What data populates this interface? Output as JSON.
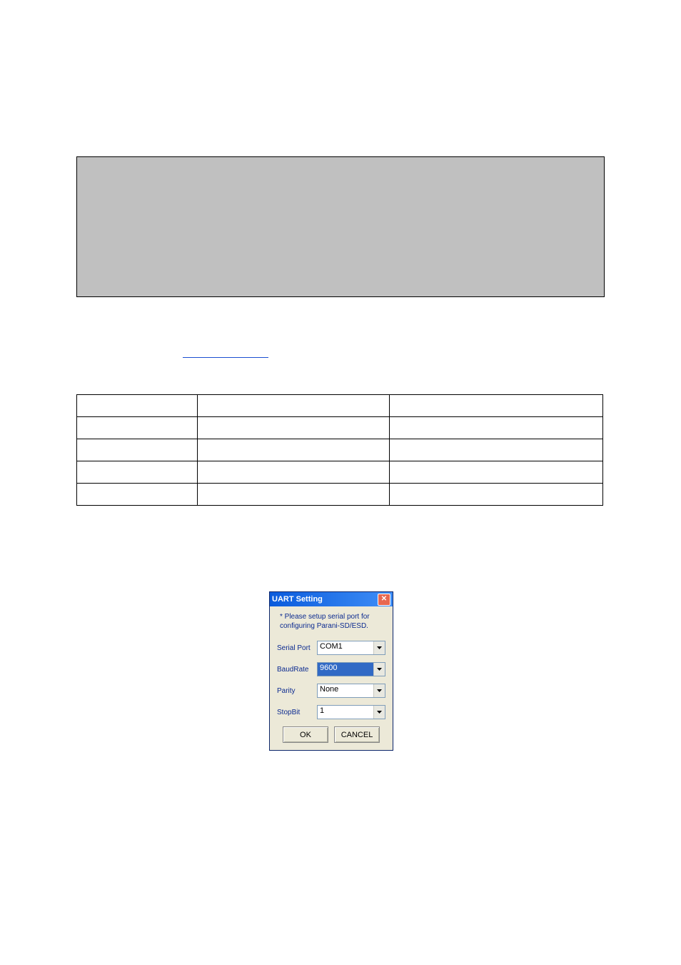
{
  "dialog": {
    "title": "UART Setting",
    "hint": "* Please setup serial port for configuring Parani-SD/ESD.",
    "fields": {
      "serial_port": {
        "label": "Serial Port",
        "value": "COM1"
      },
      "baud_rate": {
        "label": "BaudRate",
        "value": "9600"
      },
      "parity": {
        "label": "Parity",
        "value": "None"
      },
      "stop_bit": {
        "label": "StopBit",
        "value": "1"
      }
    },
    "buttons": {
      "ok": "OK",
      "cancel": "CANCEL"
    }
  }
}
